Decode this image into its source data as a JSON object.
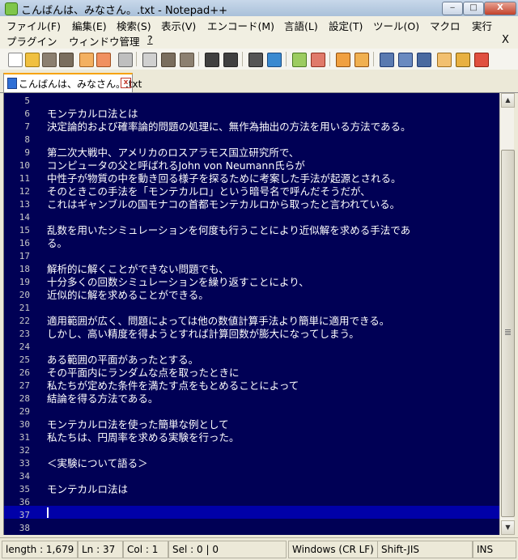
{
  "window": {
    "title": "こんばんは、みなさん。.txt - Notepad++",
    "min_label": "‒",
    "max_label": "□",
    "close_label": "X"
  },
  "menu": {
    "row1": [
      "ファイル(F)",
      "編集(E)",
      "検索(S)",
      "表示(V)",
      "エンコード(M)",
      "言語(L)",
      "設定(T)",
      "ツール(O)",
      "マクロ",
      "実行"
    ],
    "row2": [
      "プラグイン",
      "ウィンドウ管理",
      "?"
    ],
    "close_label": "X"
  },
  "toolbar": {
    "icons": [
      "new-file-icon",
      "open-file-icon",
      "save-icon",
      "save-all-icon",
      "close-icon",
      "close-all-icon",
      "print-icon",
      "cut-icon",
      "copy-icon",
      "paste-icon",
      "undo-icon",
      "redo-icon",
      "find-icon",
      "replace-icon",
      "zoom-in-icon",
      "zoom-out-icon",
      "sync-vertical-icon",
      "sync-horizontal-icon",
      "word-wrap-icon",
      "show-all-chars-icon",
      "indent-guide-icon",
      "macro-record-icon",
      "macro-stop-icon",
      "macro-play-icon"
    ]
  },
  "tab": {
    "label": "こんばんは、みなさん。.txt",
    "close_label": "x"
  },
  "editor": {
    "background": "#000055",
    "current_line_color": "#0000a8",
    "lines": [
      {
        "num": "5",
        "text": ""
      },
      {
        "num": "6",
        "text": "モンテカルロ法とは"
      },
      {
        "num": "7",
        "text": "決定論的および確率論的問題の処理に、無作為抽出の方法を用いる方法である。"
      },
      {
        "num": "8",
        "text": ""
      },
      {
        "num": "9",
        "text": "第二次大戦中、アメリカのロスアラモス国立研究所で、"
      },
      {
        "num": "10",
        "text": "コンピュータの父と呼ばれるJohn von Neumann氏らが"
      },
      {
        "num": "11",
        "text": "中性子が物質の中を動き回る様子を探るために考案した手法が起源とされる。"
      },
      {
        "num": "12",
        "text": "そのときこの手法を「モンテカルロ」という暗号名で呼んだそうだが、"
      },
      {
        "num": "13",
        "text": "これはギャンブルの国モナコの首都モンテカルロから取ったと言われている。"
      },
      {
        "num": "14",
        "text": ""
      },
      {
        "num": "15",
        "text": "乱数を用いたシミュレーションを何度も行うことにより近似解を求める手法であ"
      },
      {
        "num": "16",
        "text": "る。"
      },
      {
        "num": "17",
        "text": ""
      },
      {
        "num": "18",
        "text": "解析的に解くことができない問題でも、"
      },
      {
        "num": "19",
        "text": "十分多くの回数シミュレーションを繰り返すことにより、"
      },
      {
        "num": "20",
        "text": "近似的に解を求めることができる。"
      },
      {
        "num": "21",
        "text": ""
      },
      {
        "num": "22",
        "text": "適用範囲が広く、問題によっては他の数値計算手法より簡単に適用できる。"
      },
      {
        "num": "23",
        "text": "しかし、高い精度を得ようとすれば計算回数が膨大になってしまう。"
      },
      {
        "num": "24",
        "text": ""
      },
      {
        "num": "25",
        "text": "ある範囲の平面があったとする。"
      },
      {
        "num": "26",
        "text": "その平面内にランダムな点を取ったときに"
      },
      {
        "num": "27",
        "text": "私たちが定めた条件を満たす点をもとめることによって"
      },
      {
        "num": "28",
        "text": "結論を得る方法である。"
      },
      {
        "num": "29",
        "text": ""
      },
      {
        "num": "30",
        "text": "モンテカルロ法を使った簡単な例として"
      },
      {
        "num": "31",
        "text": "私たちは、円周率を求める実験を行った。"
      },
      {
        "num": "32",
        "text": ""
      },
      {
        "num": "33",
        "text": "＜実験について語る＞"
      },
      {
        "num": "34",
        "text": ""
      },
      {
        "num": "35",
        "text": "モンテカルロ法は"
      },
      {
        "num": "36",
        "text": ""
      },
      {
        "num": "37",
        "text": ""
      },
      {
        "num": "38",
        "text": ""
      }
    ]
  },
  "status": {
    "length": "length : 1,679",
    "ln": "Ln : 37",
    "col": "Col : 1",
    "sel": "Sel : 0 | 0",
    "eol": "Windows (CR LF)",
    "encoding": "Shift-JIS",
    "mode": "INS"
  }
}
